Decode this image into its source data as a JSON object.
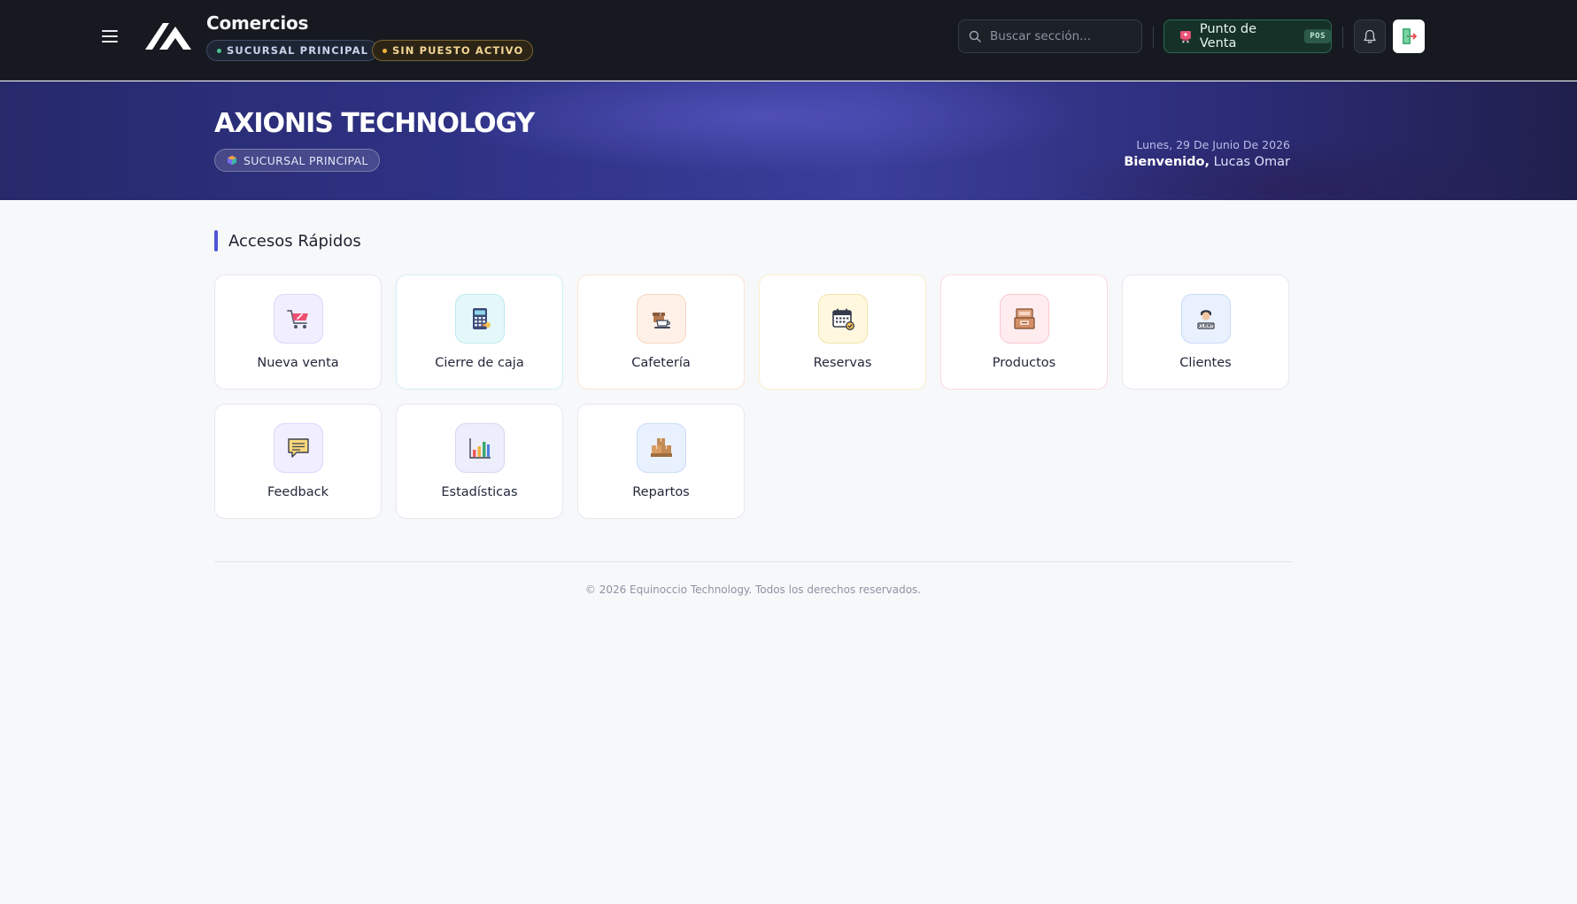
{
  "header": {
    "app_title": "Comercios",
    "branch_pill": "SUCURSAL PRINCIPAL",
    "post_pill": "SIN PUESTO ACTIVO",
    "search_placeholder": "Buscar sección...",
    "pos_button_label": "Punto de Venta",
    "pos_badge": "POS"
  },
  "hero": {
    "company": "AXIONIS TECHNOLOGY",
    "branch": "SUCURSAL PRINCIPAL",
    "date": "Lunes, 29 De Junio De 2026",
    "welcome_prefix": "Bienvenido,",
    "user_name": "Lucas Omar"
  },
  "quick_access": {
    "title": "Accesos Rápidos",
    "tiles": [
      {
        "label": "Nueva venta",
        "icon": "shopping-cart-icon"
      },
      {
        "label": "Cierre de caja",
        "icon": "calculator-icon"
      },
      {
        "label": "Cafetería",
        "icon": "coffee-cup-icon"
      },
      {
        "label": "Reservas",
        "icon": "calendar-icon"
      },
      {
        "label": "Productos",
        "icon": "product-box-icon"
      },
      {
        "label": "Clientes",
        "icon": "client-icon"
      },
      {
        "label": "Feedback",
        "icon": "feedback-chat-icon"
      },
      {
        "label": "Estadísticas",
        "icon": "bar-chart-icon"
      },
      {
        "label": "Repartos",
        "icon": "delivery-boxes-icon"
      }
    ]
  },
  "footer": {
    "copyright": "© 2026 Equinoccio Technology. Todos los derechos reservados."
  },
  "colors": {
    "topbar": "#161a20",
    "accent": "#4c55d6",
    "pos_green": "#163128",
    "branch_dot": "#47c48a",
    "post_dot": "#f2b33d"
  }
}
